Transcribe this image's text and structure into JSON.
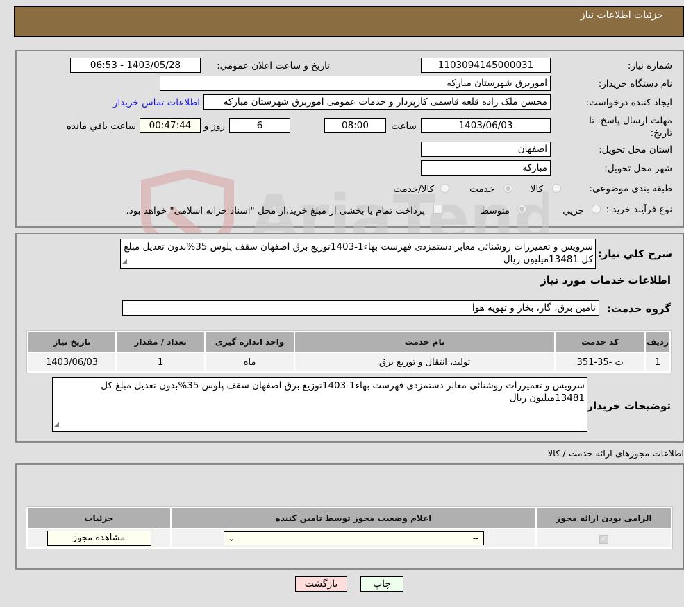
{
  "header": {
    "title": "جزئیات اطلاعات نیاز"
  },
  "form": {
    "need_number": {
      "label": "شماره نیاز:",
      "value": "1103094145000031"
    },
    "announce_datetime": {
      "label": "تاریخ و ساعت اعلان عمومي:",
      "value": "1403/05/28 - 06:53"
    },
    "buyer_org": {
      "label": "نام دستگاه خریدار:",
      "value": "اموربرق شهرستان مبارکه"
    },
    "requester": {
      "label": "ایجاد کننده درخواست:",
      "value": "محسن ملک زاده قلعه قاسمی کارپرداز و خدمات عمومی اموربرق شهرستان مبارکه",
      "contact_link": "اطلاعات تماس خریدار"
    },
    "deadline": {
      "label": "مهلت ارسال پاسخ: تا تاریخ:",
      "date": "1403/06/03",
      "time_label": "ساعت",
      "time": "08:00",
      "days": "6",
      "days_label": "روز و",
      "remaining": "00:47:44",
      "remaining_label": "ساعت باقي مانده"
    },
    "province": {
      "label": "استان محل تحویل:",
      "value": "اصفهان"
    },
    "city": {
      "label": "شهر محل تحویل:",
      "value": "مبارکه"
    },
    "category": {
      "label": "طبقه بندی موضوعی:",
      "options": [
        {
          "label": "کالا",
          "selected": false
        },
        {
          "label": "خدمت",
          "selected": true
        },
        {
          "label": "کالا/خدمت",
          "selected": false
        }
      ]
    },
    "process_type": {
      "label": "نوع فرآیند خرید :",
      "options": [
        {
          "label": "جزيي",
          "selected": false
        },
        {
          "label": "متوسط",
          "selected": true
        }
      ],
      "treasury_checkbox": {
        "label": "پرداخت تمام یا بخشی از مبلغ خرید،از محل \"اسناد خزانه اسلامی\" خواهد بود.",
        "checked": false
      }
    }
  },
  "summary": {
    "label": "شرح کلي نیاز:",
    "value": "سرویس و تعمیررات روشنائی معابر دستمزدی فهرست بهاء1-1403توزیع برق اصفهان سقف پلوس 35%بدون تعدیل مبلغ کل 13481میلیون ریال"
  },
  "services": {
    "section_title": "اطلاعات خدمات مورد نیاز",
    "group_label": "گروه خدمت:",
    "group_value": "تامین برق، گاز، بخار و تهویه هوا",
    "table": {
      "headers": [
        "ردیف",
        "کد خدمت",
        "نام خدمت",
        "واحد اندازه گیری",
        "تعداد / مقدار",
        "تاریخ نیاز"
      ],
      "rows": [
        [
          "1",
          "ت -35-351",
          "تولید، انتقال و توزیع برق",
          "ماه",
          "1",
          "1403/06/03"
        ]
      ]
    }
  },
  "buyer_notes": {
    "label": "توضیحات خریدار:",
    "value": "سرویس و تعمیررات روشنائی معابر دستمزدی فهرست بهاء1-1403توزیع برق اصفهان سقف پلوس 35%بدون تعدیل مبلغ کل 13481میلیون ریال"
  },
  "permits": {
    "section_title": "اطلاعات مجوزهای ارائه خدمت / کالا",
    "table": {
      "headers": [
        "الزامی بودن ارائه مجوز",
        "اعلام وضعیت مجوز توسط تامین کننده",
        "جزئیات"
      ],
      "rows": [
        {
          "required_checked": true,
          "status_select": "--",
          "details_button": "مشاهده مجوز"
        }
      ]
    }
  },
  "actions": {
    "print": "چاپ",
    "back": "بازگشت"
  },
  "colors": {
    "header_bg": "#8b6d42",
    "page_bg": "#e0e0e0",
    "link": "#1a1adb",
    "back_btn": "#ffdddd",
    "print_btn": "#eeffee"
  }
}
